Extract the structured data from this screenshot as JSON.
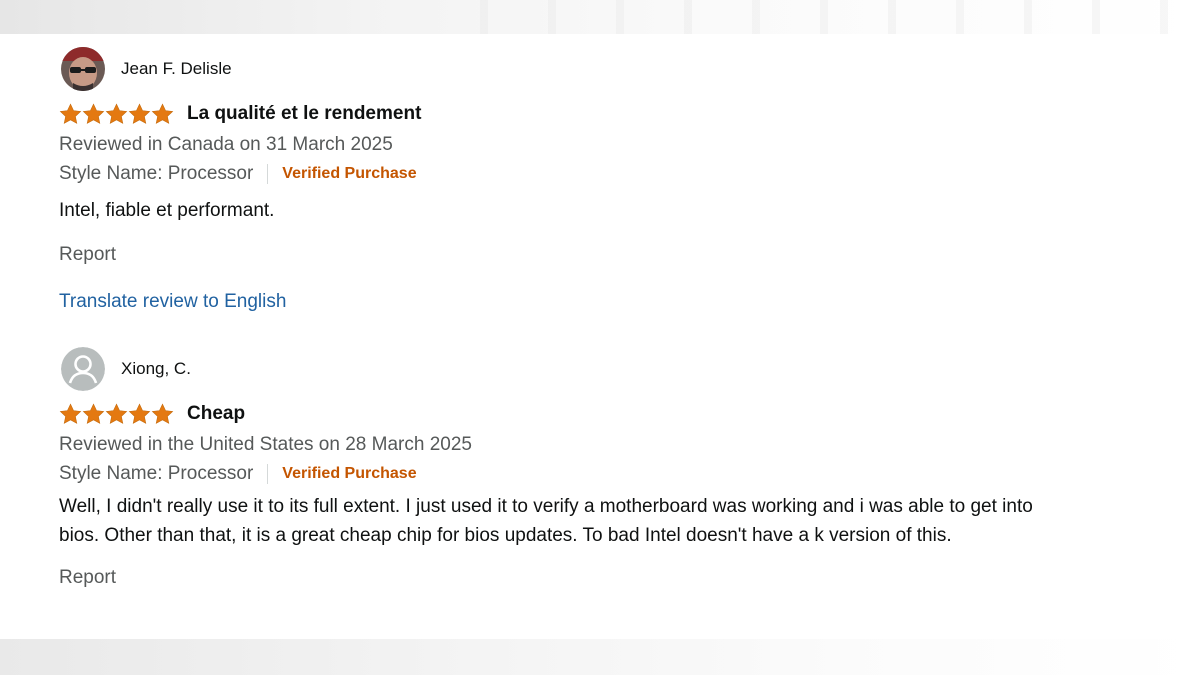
{
  "reviews": [
    {
      "reviewer": "Jean F. Delisle",
      "avatar": "reviewer-photo",
      "rating": 5,
      "title": "La qualité et le rendement",
      "date_line": "Reviewed in Canada on 31 March 2025",
      "style_name": "Style Name: Processor",
      "verified": "Verified Purchase",
      "body": "Intel, fiable et performant.",
      "report": "Report",
      "translate": "Translate review to English"
    },
    {
      "reviewer": "Xiong, C.",
      "avatar": "default-user-icon",
      "rating": 5,
      "title": "Cheap",
      "date_line": "Reviewed in the United States on 28 March 2025",
      "style_name": "Style Name: Processor",
      "verified": "Verified Purchase",
      "body": "Well, I didn't really use it to its full extent. I just used it to verify a motherboard was working and i was able to get into bios. Other than that, it is a great cheap chip for bios updates. To bad Intel doesn't have a k version of this.",
      "report": "Report"
    }
  ],
  "colors": {
    "star": "#e47911",
    "verified": "#c45500",
    "link": "#2162a1",
    "muted_text": "#565959"
  }
}
